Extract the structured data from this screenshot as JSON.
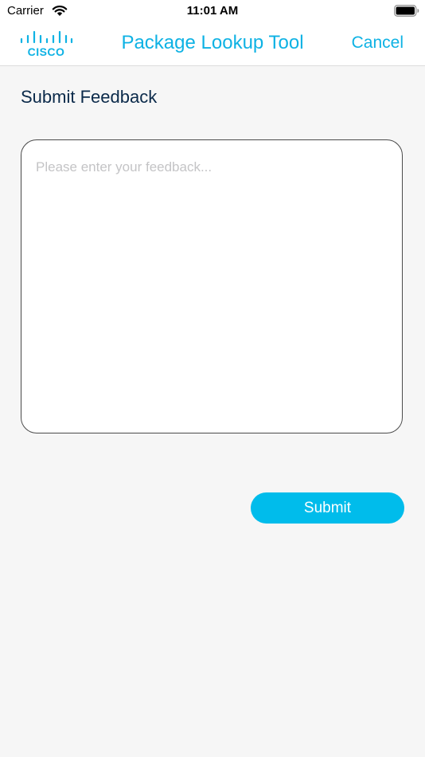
{
  "status_bar": {
    "carrier": "Carrier",
    "time": "11:01 AM"
  },
  "nav": {
    "logo_text": "CISCO",
    "title": "Package Lookup Tool",
    "cancel_label": "Cancel"
  },
  "page": {
    "title": "Submit Feedback"
  },
  "feedback": {
    "value": "",
    "placeholder": "Please enter your feedback..."
  },
  "submit": {
    "label": "Submit"
  },
  "colors": {
    "accent": "#0eb2e4",
    "button": "#00bceb",
    "heading": "#0b2a4a",
    "background": "#f6f6f6"
  }
}
